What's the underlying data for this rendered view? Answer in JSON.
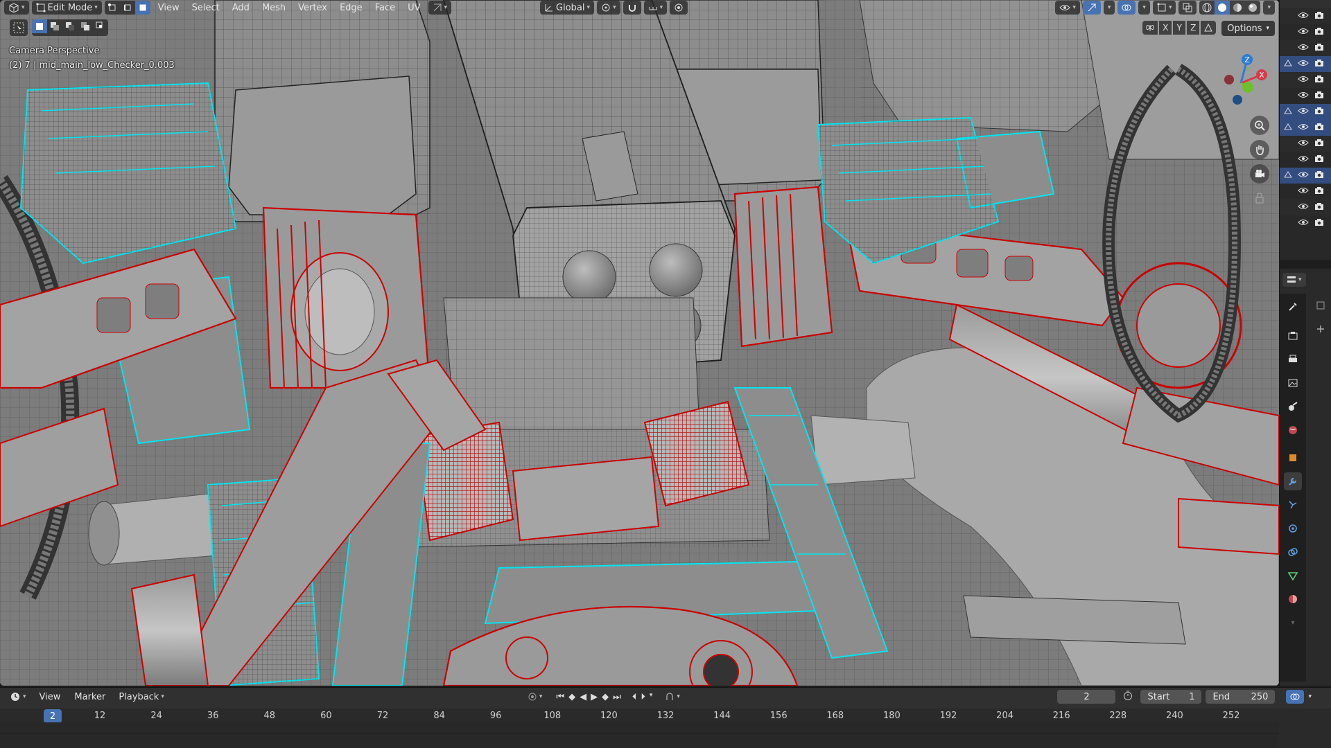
{
  "header": {
    "mode_label": "Edit Mode",
    "menus": [
      "View",
      "Select",
      "Add",
      "Mesh",
      "Vertex",
      "Edge",
      "Face",
      "UV"
    ],
    "transform_orientation": "Global",
    "axis_labels": [
      "X",
      "Y",
      "Z"
    ],
    "options_label": "Options"
  },
  "viewport": {
    "camera_label": "Camera Perspective",
    "object_label": "(2) 7 | mid_main_low_Checker_0.003",
    "gizmo_axes": [
      "Z",
      "Y",
      "X"
    ]
  },
  "outliner": {
    "rows_selected": [
      false,
      false,
      false,
      true,
      false,
      false,
      true,
      true,
      false,
      false,
      true,
      false,
      false,
      false
    ]
  },
  "timeline": {
    "menus": [
      "View",
      "Marker"
    ],
    "playback_label": "Playback",
    "current_frame": "2",
    "start_label": "Start",
    "start_value": "1",
    "end_label": "End",
    "end_value": "250",
    "playhead_frame": "2",
    "ruler_ticks": [
      "12",
      "24",
      "36",
      "48",
      "60",
      "72",
      "84",
      "96",
      "108",
      "120",
      "132",
      "144",
      "156",
      "168",
      "180",
      "192",
      "204",
      "216",
      "228",
      "240",
      "252"
    ]
  },
  "colors": {
    "accent": "#4772b3",
    "wire_selected": "#d01515",
    "wire_highlight": "#00e5f0",
    "mesh": "#8c8c8c"
  }
}
